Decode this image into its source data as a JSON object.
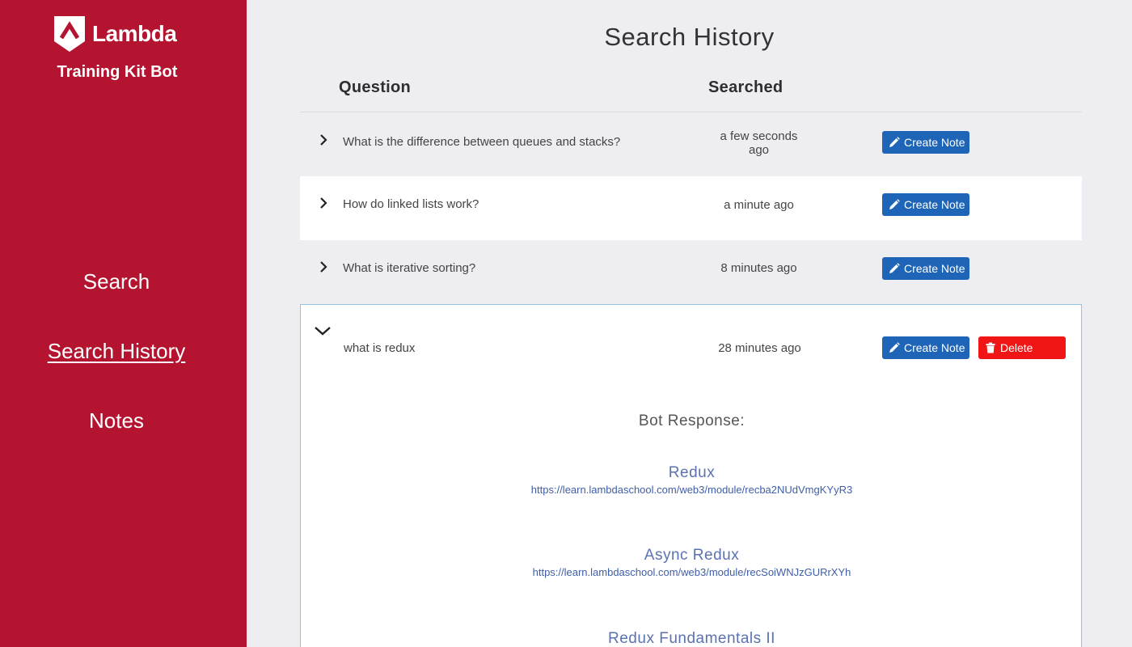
{
  "sidebar": {
    "brand_name": "Lambda",
    "brand_subtitle": "Training Kit Bot",
    "nav": [
      {
        "label": "Search",
        "active": false
      },
      {
        "label": "Search History",
        "active": true
      },
      {
        "label": "Notes",
        "active": false
      }
    ]
  },
  "page": {
    "title": "Search History",
    "columns": {
      "question": "Question",
      "searched": "Searched"
    }
  },
  "history": [
    {
      "question": "What is the difference between queues and stacks?",
      "searched_line1": "a few seconds",
      "searched_line2": "ago",
      "expanded": false,
      "create_note_label": "Create Note"
    },
    {
      "question": "How do linked lists work?",
      "searched": "a minute ago",
      "expanded": false,
      "create_note_label": "Create Note"
    },
    {
      "question": "What is iterative sorting?",
      "searched": "8 minutes ago",
      "expanded": false,
      "create_note_label": "Create Note"
    },
    {
      "question": "what is redux",
      "searched": "28 minutes ago",
      "expanded": true,
      "create_note_label": "Create Note",
      "delete_label": "Delete"
    }
  ],
  "bot_response": {
    "title": "Bot Response:",
    "links": [
      {
        "title": "Redux",
        "url": "https://learn.lambdaschool.com/web3/module/recba2NUdVmgKYyR3"
      },
      {
        "title": "Async Redux",
        "url": "https://learn.lambdaschool.com/web3/module/recSoiWNJzGURrXYh"
      },
      {
        "title": "Redux Fundamentals II",
        "url": ""
      }
    ]
  },
  "colors": {
    "sidebar": "#b41430",
    "primary_button": "#1f65b7",
    "danger_button": "#f01616",
    "link": "#5a72b2",
    "background": "#eeeef2"
  },
  "icons": {
    "logo": "lambda-logo-icon",
    "collapsed": "chevron-right-icon",
    "expanded": "chevron-down-icon",
    "create_note": "pencil-icon",
    "delete": "trash-icon"
  }
}
